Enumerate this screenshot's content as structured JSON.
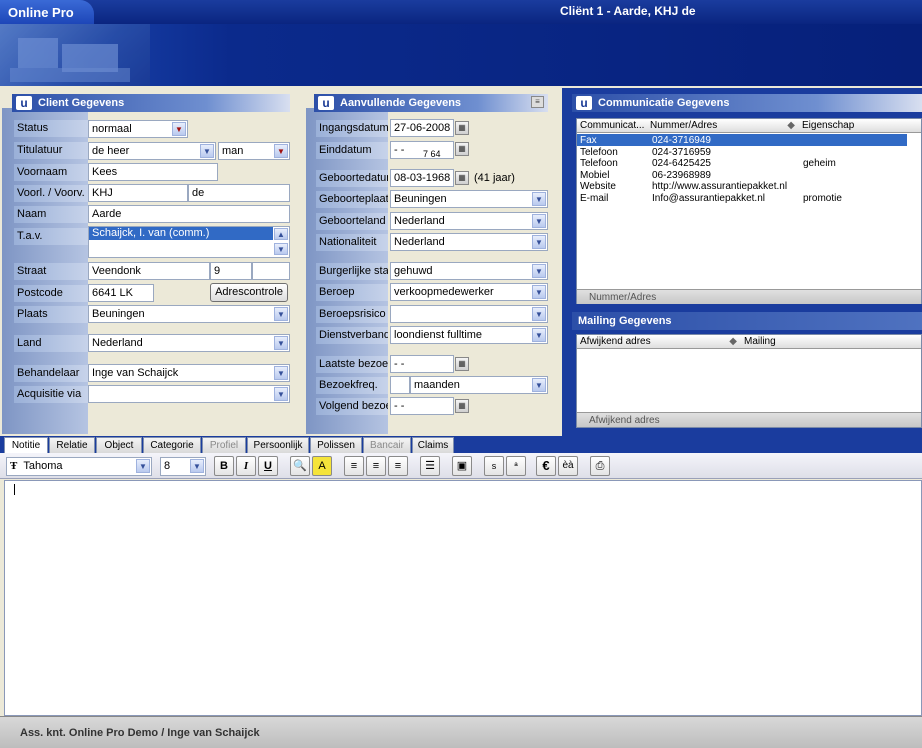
{
  "app": {
    "name": "Online Pro",
    "document_title": "Cliënt 1  -  Aarde, KHJ de"
  },
  "client": {
    "header": "Client Gegevens",
    "labels": {
      "status": "Status",
      "titulatuur": "Titulatuur",
      "voornaam": "Voornaam",
      "voorl": "Voorl. / Voorv.",
      "naam": "Naam",
      "tav": "T.a.v.",
      "straat": "Straat",
      "postcode": "Postcode",
      "plaats": "Plaats",
      "land": "Land",
      "behandelaar": "Behandelaar",
      "acquisitie": "Acquisitie via"
    },
    "values": {
      "status": "normaal",
      "titulatuur": "de heer",
      "geslacht": "man",
      "voornaam": "Kees",
      "voorletters": "KHJ",
      "voorvoegsel": "de",
      "naam": "Aarde",
      "tav": "Schaijck, I. van (comm.)",
      "straat": "Veendonk",
      "huisnummer": "9",
      "toevoeging": "",
      "postcode": "6641 LK",
      "plaats": "Beuningen",
      "land": "Nederland",
      "behandelaar": "Inge van Schaijck",
      "acquisitie": ""
    },
    "adrescontrole": "Adrescontrole"
  },
  "aanvullend": {
    "header": "Aanvullende Gegevens",
    "labels": {
      "ingangsdatum": "Ingangsdatum",
      "einddatum": "Einddatum",
      "geboortedatum": "Geboortedatum",
      "geboorteplaats": "Geboorteplaats",
      "geboorteland": "Geboorteland",
      "nationaliteit": "Nationaliteit",
      "burgerlijke_staat": "Burgerlijke staat",
      "beroep": "Beroep",
      "beroepsrisico": "Beroepsrisico",
      "dienstverband": "Dienstverband",
      "laatste_bezoek": "Laatste bezoek",
      "bezoekfreq": "Bezoekfreq.",
      "volgend_bezoek": "Volgend bezoek"
    },
    "values": {
      "ingangsdatum": "27-06-2008",
      "einddatum": "- -",
      "einddatum_extra": "7 64",
      "geboortedatum": "08-03-1968",
      "leeftijd": "(41 jaar)",
      "geboorteplaats": "Beuningen",
      "geboorteland": "Nederland",
      "nationaliteit": "Nederland",
      "burgerlijke_staat": "gehuwd",
      "beroep": "verkoopmedewerker",
      "beroepsrisico": "",
      "dienstverband": "loondienst fulltime",
      "laatste_bezoek": "- -",
      "bezoekfreq_num": "",
      "bezoekfreq_unit": "maanden",
      "volgend_bezoek": "- -"
    }
  },
  "communicatie": {
    "header": "Communicatie Gegevens",
    "columns": [
      "Communicat...",
      "Nummer/Adres",
      "Eigenschap"
    ],
    "rows": [
      {
        "type": "Fax",
        "value": "024-3716949",
        "prop": ""
      },
      {
        "type": "Telefoon",
        "value": "024-3716959",
        "prop": ""
      },
      {
        "type": "Telefoon",
        "value": "024-6425425",
        "prop": "geheim"
      },
      {
        "type": "Mobiel",
        "value": "06-23968989",
        "prop": ""
      },
      {
        "type": "Website",
        "value": "http://www.assurantiepakket.nl",
        "prop": ""
      },
      {
        "type": "E-mail",
        "value": "Info@assurantiepakket.nl",
        "prop": "promotie"
      }
    ],
    "footer": "Nummer/Adres"
  },
  "mailing": {
    "header": "Mailing Gegevens",
    "columns": [
      "Afwijkend adres",
      "Mailing"
    ],
    "footer": "Afwijkend adres"
  },
  "tabs": [
    "Notitie",
    "Relatie",
    "Object",
    "Categorie",
    "Profiel",
    "Persoonlijk",
    "Polissen",
    "Bancair",
    "Claims"
  ],
  "toolbar": {
    "font": "Tahoma",
    "size": "8",
    "bold": "B",
    "italic": "I",
    "underline": "U",
    "highlight": "A",
    "subscript": "s",
    "superscript": "ª",
    "euro": "€",
    "accent": "èà"
  },
  "statusbar": "Ass. knt. Online Pro Demo / Inge van Schaijck",
  "colors": {
    "titlebar": "#0a2580",
    "selection": "#316ac5",
    "panel": "#ece9d8"
  }
}
